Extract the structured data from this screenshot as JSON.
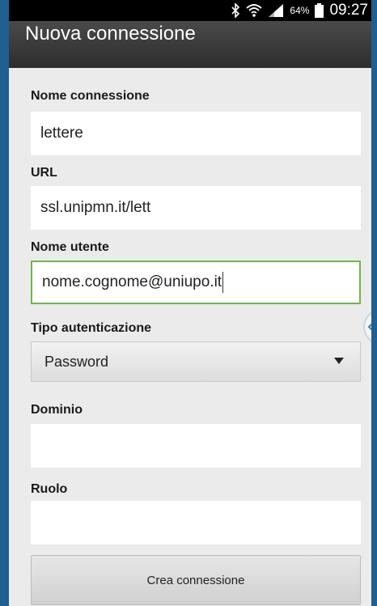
{
  "status_bar": {
    "bluetooth_icon": "bluetooth-icon",
    "wifi_icon": "wifi-icon",
    "signal_icon": "signal-icon",
    "battery_percent": "64%",
    "battery_icon": "battery-icon",
    "time": "09:27"
  },
  "title": "Nuova connessione",
  "form": {
    "connection_name": {
      "label": "Nome connessione",
      "value": "lettere"
    },
    "url": {
      "label": "URL",
      "value": "ssl.unipmn.it/lett"
    },
    "username": {
      "label": "Nome utente",
      "value": "nome.cognome@uniupo.it"
    },
    "auth_type": {
      "label": "Tipo autenticazione",
      "value": "Password"
    },
    "domain": {
      "label": "Dominio",
      "value": ""
    },
    "role": {
      "label": "Ruolo",
      "value": ""
    },
    "submit_label": "Crea connessione"
  },
  "colors": {
    "frame": "#1f5f92",
    "titlebar": "#3a3a3a",
    "active_border": "#6dba3f",
    "background": "#ebebeb"
  }
}
